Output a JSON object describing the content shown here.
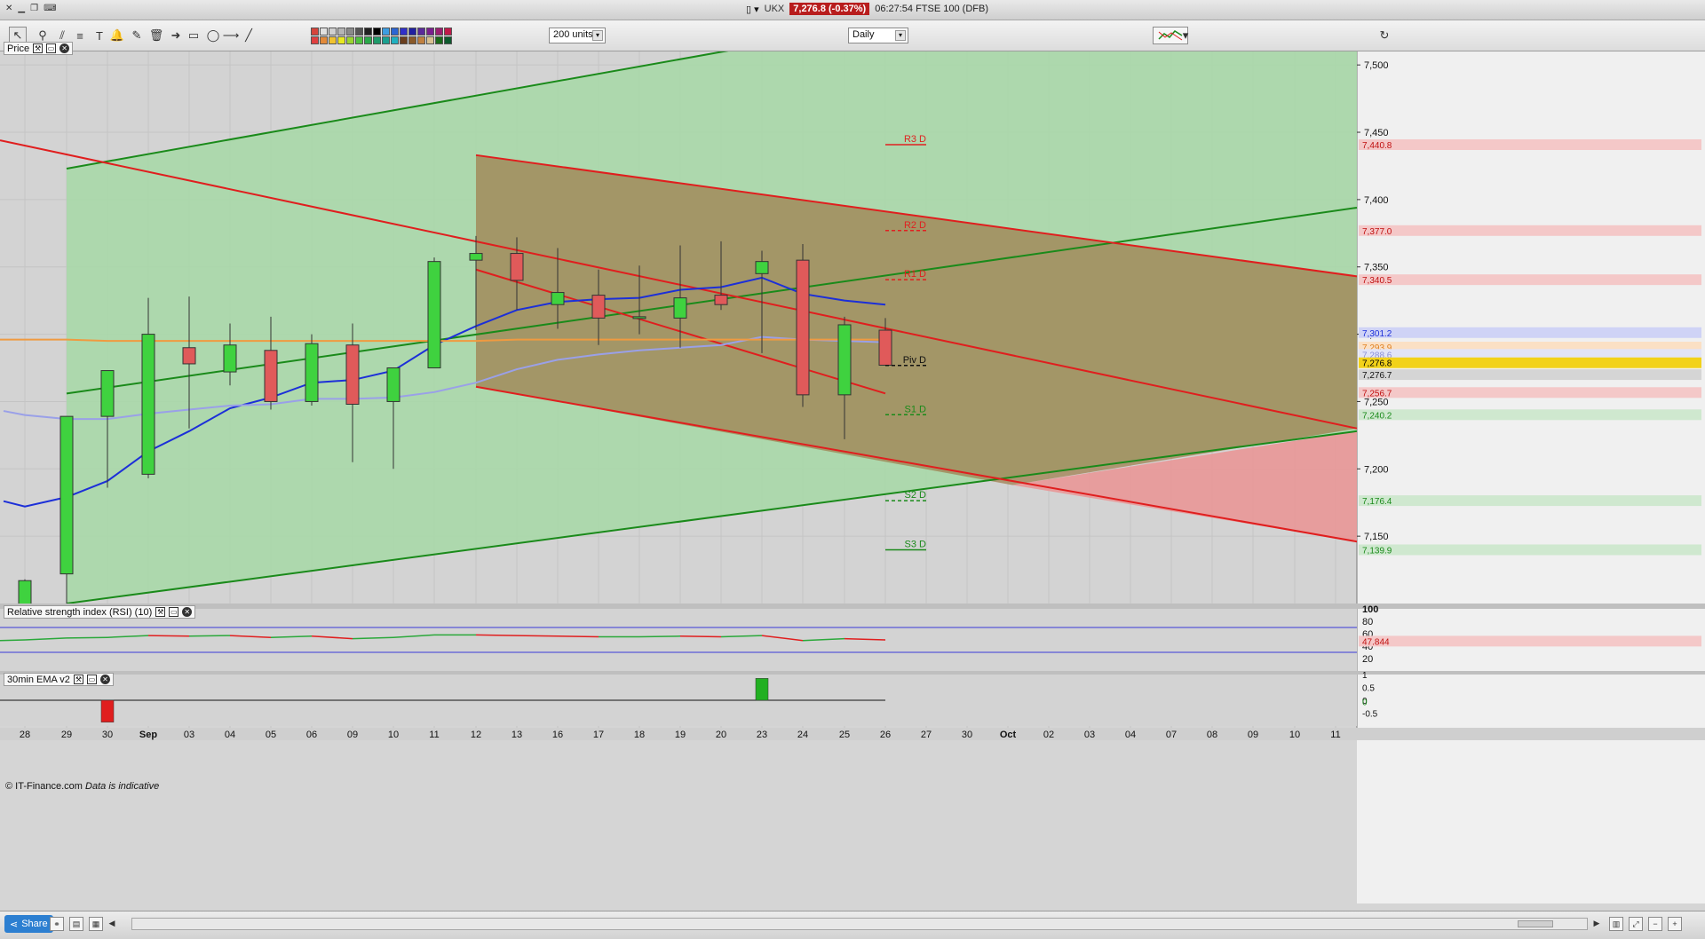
{
  "window": {
    "ticker": "UKX",
    "price_badge": "7,276.8 (-0.37%)",
    "info": "06:27:54 FTSE 100 (DFB)"
  },
  "toolbar": {
    "units_value": "200 units",
    "interval_value": "Daily",
    "colors": [
      "#d6453c",
      "#e1e1e1",
      "#d0d0d0",
      "#b5b5b5",
      "#8a8a8a",
      "#555555",
      "#222222",
      "#000000",
      "#3d9ce0",
      "#2d66d2",
      "#3030c8",
      "#2020a0",
      "#5a2a9a",
      "#7a1f8e",
      "#9a1f70",
      "#c01a4a",
      "#e04040",
      "#e28a3a",
      "#f0c230",
      "#e8e820",
      "#9ad430",
      "#4ec040",
      "#2aa84a",
      "#1f9a6a",
      "#1aa090",
      "#20b0c0",
      "#6a3e1e",
      "#8a5a2a",
      "#c08040",
      "#d8c090",
      "#1a6a1a",
      "#0e5a2e"
    ]
  },
  "price_panel": {
    "label": "Price"
  },
  "rsi_panel": {
    "label": "Relative strength index (RSI) (10)",
    "value_badge": "47.844",
    "ticks": [
      "100",
      "80",
      "60",
      "40",
      "20"
    ]
  },
  "ema_panel": {
    "label": "30min EMA v2",
    "ticks": [
      "1",
      "0.5",
      "0",
      "0",
      "-0.5"
    ]
  },
  "copyright": {
    "text": "© IT-Finance.com",
    "note": "Data is indicative"
  },
  "status": {
    "share_label": "Share"
  },
  "chart_data": {
    "type": "candlestick",
    "y_ticks": [
      "7,500",
      "7,450",
      "7,400",
      "7,350",
      "7,300",
      "7,250",
      "7,200",
      "7,150"
    ],
    "ylim": [
      7100,
      7510
    ],
    "x_labels": [
      "28",
      "29",
      "30",
      "Sep",
      "03",
      "04",
      "05",
      "06",
      "09",
      "10",
      "11",
      "12",
      "13",
      "16",
      "17",
      "18",
      "19",
      "20",
      "23",
      "24",
      "25",
      "26",
      "27",
      "30",
      "Oct",
      "02",
      "03",
      "04",
      "07",
      "08",
      "09",
      "10",
      "11"
    ],
    "candles": [
      {
        "date": "28",
        "open": 7098,
        "high": 7118,
        "low": 7094,
        "close": 7117
      },
      {
        "date": "29",
        "open": 7122,
        "high": 7200,
        "low": 7100,
        "close": 7239
      },
      {
        "date": "30",
        "open": 7239,
        "high": 7244,
        "low": 7186,
        "close": 7273
      },
      {
        "date": "Sep",
        "open": 7196,
        "high": 7327,
        "low": 7193,
        "close": 7300
      },
      {
        "date": "03",
        "open": 7290,
        "high": 7328,
        "low": 7230,
        "close": 7278
      },
      {
        "date": "04",
        "open": 7272,
        "high": 7308,
        "low": 7262,
        "close": 7292
      },
      {
        "date": "05",
        "open": 7288,
        "high": 7313,
        "low": 7244,
        "close": 7250
      },
      {
        "date": "06",
        "open": 7250,
        "high": 7300,
        "low": 7247,
        "close": 7293
      },
      {
        "date": "09",
        "open": 7292,
        "high": 7308,
        "low": 7205,
        "close": 7248
      },
      {
        "date": "10",
        "open": 7250,
        "high": 7270,
        "low": 7200,
        "close": 7275
      },
      {
        "date": "11",
        "open": 7275,
        "high": 7357,
        "low": 7275,
        "close": 7354
      },
      {
        "date": "12",
        "open": 7355,
        "high": 7373,
        "low": 7303,
        "close": 7360
      },
      {
        "date": "13",
        "open": 7360,
        "high": 7372,
        "low": 7318,
        "close": 7340
      },
      {
        "date": "16",
        "open": 7322,
        "high": 7364,
        "low": 7304,
        "close": 7331
      },
      {
        "date": "17",
        "open": 7329,
        "high": 7348,
        "low": 7292,
        "close": 7312
      },
      {
        "date": "18",
        "open": 7313,
        "high": 7351,
        "low": 7300,
        "close": 7313
      },
      {
        "date": "19",
        "open": 7312,
        "high": 7366,
        "low": 7290,
        "close": 7327
      },
      {
        "date": "20",
        "open": 7329,
        "high": 7369,
        "low": 7318,
        "close": 7322
      },
      {
        "date": "23",
        "open": 7345,
        "high": 7362,
        "low": 7286,
        "close": 7354
      },
      {
        "date": "24",
        "open": 7355,
        "high": 7367,
        "low": 7246,
        "close": 7255
      },
      {
        "date": "25",
        "open": 7255,
        "high": 7313,
        "low": 7222,
        "close": 7307
      },
      {
        "date": "26",
        "open": 7303,
        "high": 7312,
        "low": 7277,
        "close": 7277
      }
    ],
    "moving_averages": [
      {
        "color": "#1c2fd8",
        "values": [
          7172,
          7179,
          7191,
          7213,
          7228,
          7245,
          7253,
          7264,
          7266,
          7273,
          7292,
          7306,
          7318,
          7324,
          7326,
          7327,
          7333,
          7335,
          7342,
          7330,
          7325,
          7322
        ]
      },
      {
        "color": "#9aa0e8",
        "values": [
          7240,
          7237,
          7237,
          7241,
          7244,
          7247,
          7248,
          7252,
          7252,
          7253,
          7257,
          7264,
          7274,
          7281,
          7285,
          7288,
          7290,
          7292,
          7298,
          7296,
          7295,
          7294
        ]
      },
      {
        "color": "#f09a40",
        "values": [
          7296,
          7296,
          7295,
          7295,
          7295,
          7295,
          7295,
          7295,
          7295,
          7295,
          7295,
          7295,
          7296,
          7296,
          7296,
          7296,
          7296,
          7296,
          7296,
          7296,
          7296,
          7296
        ]
      }
    ],
    "pivots": [
      {
        "label": "R3 D",
        "value": 7440.8,
        "color": "#e02020",
        "style": "solid"
      },
      {
        "label": "R2 D",
        "value": 7377.0,
        "color": "#e02020",
        "style": "dashed"
      },
      {
        "label": "R1 D",
        "value": 7340.5,
        "color": "#e02020",
        "style": "dashed"
      },
      {
        "label": "Piv D",
        "value": 7276.8,
        "color": "#111111",
        "style": "dashed"
      },
      {
        "label": "S1 D",
        "value": 7240.2,
        "color": "#1a8a1a",
        "style": "dashed"
      },
      {
        "label": "S2 D",
        "value": 7176.4,
        "color": "#1a8a1a",
        "style": "dashed"
      },
      {
        "label": "S3 D",
        "value": 7139.9,
        "color": "#1a8a1a",
        "style": "solid"
      }
    ],
    "right_badges": [
      {
        "text": "7,440.8",
        "value": 7440.8,
        "bg": "#f4c8c8",
        "fg": "#c01010"
      },
      {
        "text": "7,377.0",
        "value": 7377.0,
        "bg": "#f4c8c8",
        "fg": "#c01010"
      },
      {
        "text": "7,340.5",
        "value": 7340.5,
        "bg": "#f4c8c8",
        "fg": "#c01010"
      },
      {
        "text": "7,301.2",
        "value": 7301.2,
        "bg": "#cfd3f6",
        "fg": "#1c2fd8"
      },
      {
        "text": "7,293.9",
        "value": 7290.5,
        "bg": "#fbe0c4",
        "fg": "#e08020"
      },
      {
        "text": "7,288.6",
        "value": 7285.0,
        "bg": "#e2e4f7",
        "fg": "#8a8fd8"
      },
      {
        "text": "7,276.8",
        "value": 7278.8,
        "bg": "#f2d21a",
        "fg": "#000000"
      },
      {
        "text": "7,276.7",
        "value": 7270.0,
        "bg": "#d5d5d5",
        "fg": "#111111"
      },
      {
        "text": "7,256.7",
        "value": 7256.7,
        "bg": "#f4c8c8",
        "fg": "#c01010"
      },
      {
        "text": "7,240.2",
        "value": 7240.2,
        "bg": "#cfe8cf",
        "fg": "#1a8a1a"
      },
      {
        "text": "7,176.4",
        "value": 7176.4,
        "bg": "#cfe8cf",
        "fg": "#1a8a1a"
      },
      {
        "text": "7,139.9",
        "value": 7139.9,
        "bg": "#cfe8cf",
        "fg": "#1a8a1a"
      }
    ],
    "rsi_values": [
      50,
      53,
      54,
      57,
      56,
      57,
      54,
      56,
      52,
      54,
      58,
      58,
      57,
      56,
      55,
      55,
      56,
      55,
      57,
      49,
      52,
      50
    ],
    "ema_bars": [
      {
        "date": "30",
        "value": -0.85,
        "color": "#e01e1e"
      },
      {
        "date": "23",
        "value": 0.85,
        "color": "#22b022"
      }
    ],
    "colors": {
      "channel_fill": "#a8d8a8",
      "red_channel_fill": "#a08050",
      "projection_fill": "#e89a9a",
      "green_line": "#1a8a1a",
      "red_line": "#e01e1e",
      "bull": "#3fd23f",
      "bear": "#e05a5a"
    }
  }
}
